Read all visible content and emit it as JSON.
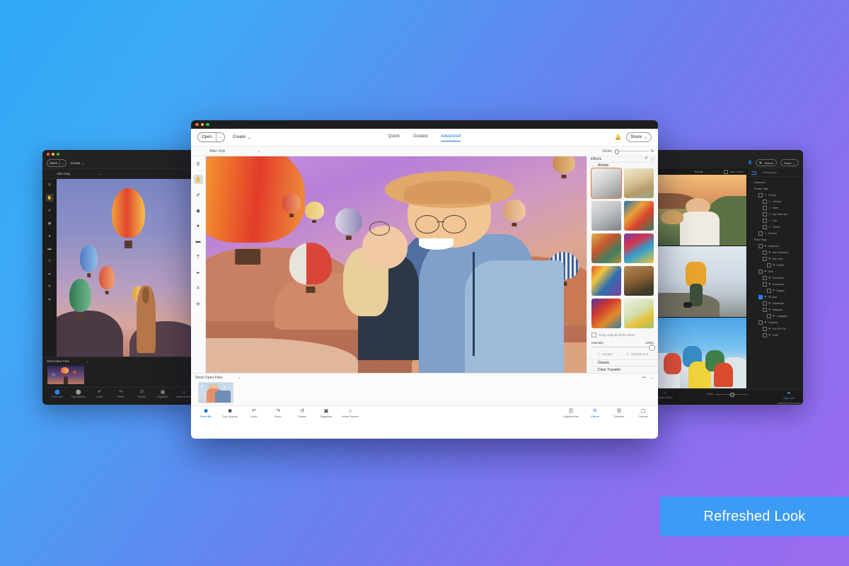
{
  "badge": {
    "text": "Refreshed Look",
    "color": "#3b9bf5"
  },
  "main_window": {
    "menubar": {
      "open_label": "Open",
      "open_caret": "⌄",
      "create_label": "Create",
      "create_caret": "⌄",
      "bell_icon": "bell-icon",
      "share_label": "Share",
      "share_caret": "⌄"
    },
    "tabs": [
      {
        "label": "Quick",
        "active": false
      },
      {
        "label": "Guided",
        "active": false
      },
      {
        "label": "Advanced",
        "active": true
      }
    ],
    "options_bar": {
      "view_mode": "After Only",
      "view_caret": "⌄",
      "zoom_label": "Zoom:",
      "zoom_unit": "%",
      "zoom_value": 0
    },
    "tools": [
      {
        "name": "zoom-tool",
        "glyph": "⚲",
        "active": false
      },
      {
        "name": "hand-tool",
        "glyph": "✋",
        "active": true
      },
      {
        "name": "spot-healing-tool",
        "glyph": "✐",
        "active": false
      },
      {
        "name": "red-eye-tool",
        "glyph": "◉",
        "active": false
      },
      {
        "name": "brush-tool",
        "glyph": "●",
        "active": false
      },
      {
        "name": "eraser-tool",
        "glyph": "▬",
        "active": false
      },
      {
        "name": "type-tool",
        "glyph": "T",
        "active": false
      },
      {
        "name": "pencil-tool",
        "glyph": "✒",
        "active": false
      },
      {
        "name": "crop-tool",
        "glyph": "⌗",
        "active": false
      },
      {
        "name": "move-tool",
        "glyph": "✛",
        "active": false
      }
    ],
    "panel": {
      "title": "Effects",
      "header_icons": [
        "reset-icon",
        "help-icon"
      ],
      "section_label": "Artistic",
      "section_caret": "⌄",
      "effects": [
        {
          "name": "pencil-sketch-effect",
          "selected": true
        },
        {
          "name": "watercolor-taj-effect",
          "selected": false
        },
        {
          "name": "graphite-city-effect",
          "selected": false
        },
        {
          "name": "fauvist-portraits-effect",
          "selected": false
        },
        {
          "name": "gauguin-effect",
          "selected": false
        },
        {
          "name": "neon-face-effect",
          "selected": false
        },
        {
          "name": "abstract-collage-effect",
          "selected": false
        },
        {
          "name": "mona-lisa-effect",
          "selected": false
        },
        {
          "name": "expressionist-effect",
          "selected": false
        },
        {
          "name": "floral-sketch-effect",
          "selected": false
        }
      ],
      "keep_colors_label": "Keep original photo colors",
      "keep_colors_checked": false,
      "intensity_label": "Intensity",
      "intensity_value": "100%",
      "subject_label": "Subject",
      "background_label": "Background",
      "accordions": [
        {
          "label": "Classic",
          "caret": "›"
        },
        {
          "label": "Color Transfer",
          "caret": "›"
        }
      ]
    },
    "photo_bin": {
      "label": "Show Open Files",
      "caret": "⌄",
      "more_icon": "•••",
      "collapse_icon": "⌄",
      "thumbnail_name": "open-file-thumbnail"
    },
    "footer_left": [
      {
        "label": "Photo Bin",
        "icon": "⬤",
        "active": true
      },
      {
        "label": "Tool Options",
        "icon": "⬤",
        "active": false
      },
      {
        "label": "Undo",
        "icon": "↶",
        "active": false
      },
      {
        "label": "Redo",
        "icon": "↷",
        "active": false
      },
      {
        "label": "Rotate",
        "icon": "↺",
        "active": false
      },
      {
        "label": "Organizer",
        "icon": "▣",
        "active": false
      },
      {
        "label": "Home Screen",
        "icon": "⌂",
        "active": false
      }
    ],
    "footer_right": [
      {
        "label": "Adjustments",
        "icon": "☲",
        "active": false
      },
      {
        "label": "Effects",
        "icon": "fx",
        "active": true
      },
      {
        "label": "Textures",
        "icon": "☰",
        "active": false
      },
      {
        "label": "Frames",
        "icon": "▢",
        "active": false
      }
    ]
  },
  "left_window": {
    "menubar": {
      "open_label": "Open",
      "open_caret": "⌄",
      "create_label": "Create",
      "create_caret": "⌄"
    },
    "options_bar": {
      "view_mode": "After Only",
      "view_caret": "⌄"
    },
    "tools": [
      {
        "name": "zoom-tool",
        "glyph": "⚲",
        "active": false
      },
      {
        "name": "hand-tool",
        "glyph": "✋",
        "active": true
      },
      {
        "name": "spot-healing-tool",
        "glyph": "✐",
        "active": false
      },
      {
        "name": "red-eye-tool",
        "glyph": "◉",
        "active": false
      },
      {
        "name": "brush-tool",
        "glyph": "●",
        "active": false
      },
      {
        "name": "eraser-tool",
        "glyph": "▬",
        "active": false
      },
      {
        "name": "type-tool",
        "glyph": "T",
        "active": false
      },
      {
        "name": "pencil-tool",
        "glyph": "✒",
        "active": false
      },
      {
        "name": "crop-tool",
        "glyph": "⌗",
        "active": false
      },
      {
        "name": "move-tool",
        "glyph": "✛",
        "active": false
      }
    ],
    "photo_bin": {
      "label": "Show Open Files",
      "caret": "⌄"
    },
    "footer": [
      {
        "label": "Photo Bin",
        "icon": "⬤",
        "active": true
      },
      {
        "label": "Tool Options",
        "icon": "⬤",
        "active": false
      },
      {
        "label": "Undo",
        "icon": "↶",
        "active": false
      },
      {
        "label": "Redo",
        "icon": "↷",
        "active": false
      },
      {
        "label": "Rotate",
        "icon": "↺",
        "active": false
      },
      {
        "label": "Organizer",
        "icon": "▣",
        "active": false
      },
      {
        "label": "Home Screen",
        "icon": "⌂",
        "active": false
      }
    ]
  },
  "right_window": {
    "topbar": {
      "person_icon": "person-icon",
      "search_label": "Search",
      "search_icon": "search-icon",
      "share_label": "Share",
      "share_caret": "⌄"
    },
    "ratings": {
      "label": "Ratings",
      "stars": "☆☆☆☆☆",
      "auto_curate_label": "Auto Curate",
      "auto_curate_checked": false
    },
    "tabs": [
      {
        "label": "Tags",
        "active": true
      },
      {
        "label": "Information",
        "active": false
      }
    ],
    "tree": [
      {
        "label": "Keywords",
        "depth": 0,
        "caret": "›",
        "box": false,
        "icon": ""
      },
      {
        "label": "People Tags",
        "depth": 0,
        "caret": "⌄",
        "box": false,
        "icon": ""
      },
      {
        "label": "Family",
        "depth": 1,
        "caret": "⌄",
        "box": true,
        "checked": false,
        "icon": "☺"
      },
      {
        "label": "Johnny",
        "depth": 2,
        "caret": "",
        "box": true,
        "checked": false,
        "icon": "☺"
      },
      {
        "label": "Mom",
        "depth": 2,
        "caret": "",
        "box": true,
        "checked": false,
        "icon": "☺"
      },
      {
        "label": "My close fam",
        "depth": 2,
        "caret": "",
        "box": true,
        "checked": false,
        "icon": "☺"
      },
      {
        "label": "Pop",
        "depth": 2,
        "caret": "",
        "box": true,
        "checked": false,
        "icon": "☺"
      },
      {
        "label": "Tommi",
        "depth": 2,
        "caret": "",
        "box": true,
        "checked": false,
        "icon": "☺"
      },
      {
        "label": "Friends",
        "depth": 1,
        "caret": "",
        "box": true,
        "checked": false,
        "icon": "☺"
      },
      {
        "label": "Place Tags",
        "depth": 0,
        "caret": "›",
        "box": false,
        "icon": ""
      },
      {
        "label": "California",
        "depth": 1,
        "caret": "",
        "box": true,
        "checked": false,
        "icon": "⚑"
      },
      {
        "label": "San Francisco",
        "depth": 2,
        "caret": "",
        "box": true,
        "checked": false,
        "icon": "⚑"
      },
      {
        "label": "San Jose",
        "depth": 2,
        "caret": "",
        "box": true,
        "checked": false,
        "icon": "⚑"
      },
      {
        "label": "SOMA",
        "depth": 3,
        "caret": "",
        "box": true,
        "checked": false,
        "icon": "⚑"
      },
      {
        "label": "Ohio",
        "depth": 1,
        "caret": "",
        "box": true,
        "checked": false,
        "icon": "⚑"
      },
      {
        "label": "Cleveland",
        "depth": 2,
        "caret": "",
        "box": true,
        "checked": false,
        "icon": "⚑"
      },
      {
        "label": "Columbus",
        "depth": 2,
        "caret": "",
        "box": true,
        "checked": false,
        "icon": "⚑"
      },
      {
        "label": "Dayton",
        "depth": 3,
        "caret": "",
        "box": true,
        "checked": false,
        "icon": "⚑"
      },
      {
        "label": "SE Asia",
        "depth": 1,
        "caret": "",
        "box": true,
        "checked": true,
        "icon": "⚑"
      },
      {
        "label": "Cambodia",
        "depth": 2,
        "caret": "",
        "box": true,
        "checked": false,
        "icon": "⚑"
      },
      {
        "label": "Malaysia",
        "depth": 2,
        "caret": "",
        "box": true,
        "checked": false,
        "icon": "⚑"
      },
      {
        "label": "Langkawi",
        "depth": 3,
        "caret": "",
        "box": true,
        "checked": false,
        "icon": "⚑"
      },
      {
        "label": "Thailand",
        "depth": 1,
        "caret": "",
        "box": true,
        "checked": false,
        "icon": "⚑"
      },
      {
        "label": "Koh Phi Phi",
        "depth": 2,
        "caret": "",
        "box": true,
        "checked": false,
        "icon": "⚑"
      },
      {
        "label": "Krabi",
        "depth": 2,
        "caret": "",
        "box": true,
        "checked": false,
        "icon": "⚑"
      }
    ],
    "footer": {
      "home_label": "Home Screen",
      "home_icon": "⌂",
      "zoom_label": "Zoom",
      "tags_label": "Tags / Info",
      "tags_icon": "⚑",
      "catalog_label": "Catalog of best years"
    }
  }
}
